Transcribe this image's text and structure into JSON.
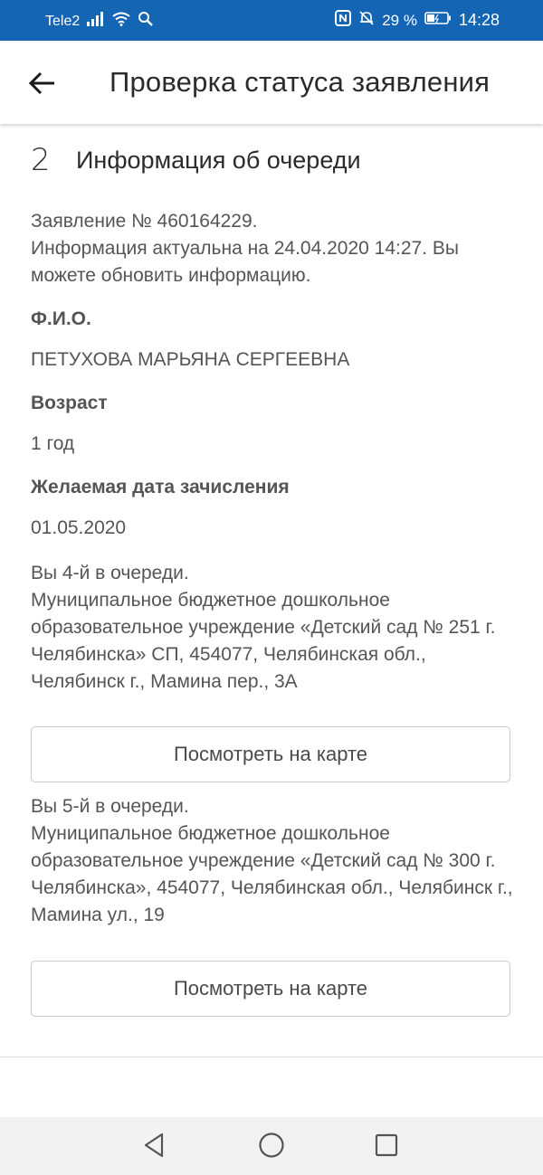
{
  "status_bar": {
    "carrier": "Tele2",
    "battery_percent": "29 %",
    "time": "14:28",
    "icons": [
      "signal-icon",
      "wifi-icon",
      "search-icon",
      "nfc-icon",
      "mute-icon",
      "battery-icon"
    ]
  },
  "app_bar": {
    "title": "Проверка статуса заявления",
    "back_icon": "arrow-left-icon"
  },
  "section": {
    "step": "2",
    "title": "Информация об очереди"
  },
  "application": {
    "number_line": "Заявление № 460164229.",
    "info_line": "Информация актуальна на 24.04.2020 14:27. Вы можете обновить информацию."
  },
  "fields": {
    "fio_label": "Ф.И.О.",
    "fio_value": "ПЕТУХОВА МАРЬЯНА СЕРГЕЕВНА",
    "age_label": "Возраст",
    "age_value": "1 год",
    "date_label": "Желаемая дата зачисления",
    "date_value": "01.05.2020"
  },
  "queues": [
    {
      "position": "Вы 4-й в очереди.",
      "institution": "Муниципальное бюджетное дошкольное образовательное учреждение «Детский сад № 251 г. Челябинска» СП, 454077, Челябинская обл., Челябинск г., Мамина пер., 3А",
      "button": "Посмотреть на карте"
    },
    {
      "position": "Вы 5-й в очереди.",
      "institution": "Муниципальное бюджетное дошкольное образовательное учреждение «Детский сад № 300 г. Челябинска», 454077, Челябинская обл., Челябинск г., Мамина ул., 19",
      "button": "Посмотреть на карте"
    }
  ],
  "nav_bar": {
    "icons": [
      "back-triangle-icon",
      "home-circle-icon",
      "recents-square-icon"
    ]
  },
  "colors": {
    "status_bar": "#1565b5",
    "text": "#555555",
    "title": "#2b2b2b"
  }
}
